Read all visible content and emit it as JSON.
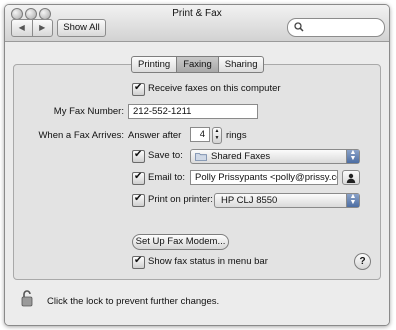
{
  "window": {
    "title": "Print & Fax"
  },
  "toolbar": {
    "back_icon": "◀",
    "forward_icon": "▶",
    "show_all_label": "Show All",
    "search": {
      "value": ""
    }
  },
  "tabs": [
    {
      "label": "Printing",
      "selected": false
    },
    {
      "label": "Faxing",
      "selected": true
    },
    {
      "label": "Sharing",
      "selected": false
    }
  ],
  "faxing": {
    "receive_label": "Receive faxes on this computer",
    "receive_checked": true,
    "fax_number_label": "My Fax Number:",
    "fax_number_value": "212-552-1211",
    "when_arrives_label": "When a Fax Arrives:",
    "answer_after_label": "Answer after",
    "rings_value": "4",
    "rings_label": "rings",
    "save_to_label": "Save to:",
    "save_to_checked": true,
    "save_to_value": "Shared Faxes",
    "email_label": "Email to:",
    "email_checked": true,
    "email_value": "Polly Prissypants <polly@prissy.com",
    "print_label": "Print on printer:",
    "print_checked": true,
    "print_value": "HP CLJ 8550",
    "setup_button_label": "Set Up Fax Modem...",
    "show_status_label": "Show fax status in menu bar",
    "show_status_checked": true,
    "help_label": "?"
  },
  "footer": {
    "lock_text": "Click the lock to prevent further changes."
  }
}
